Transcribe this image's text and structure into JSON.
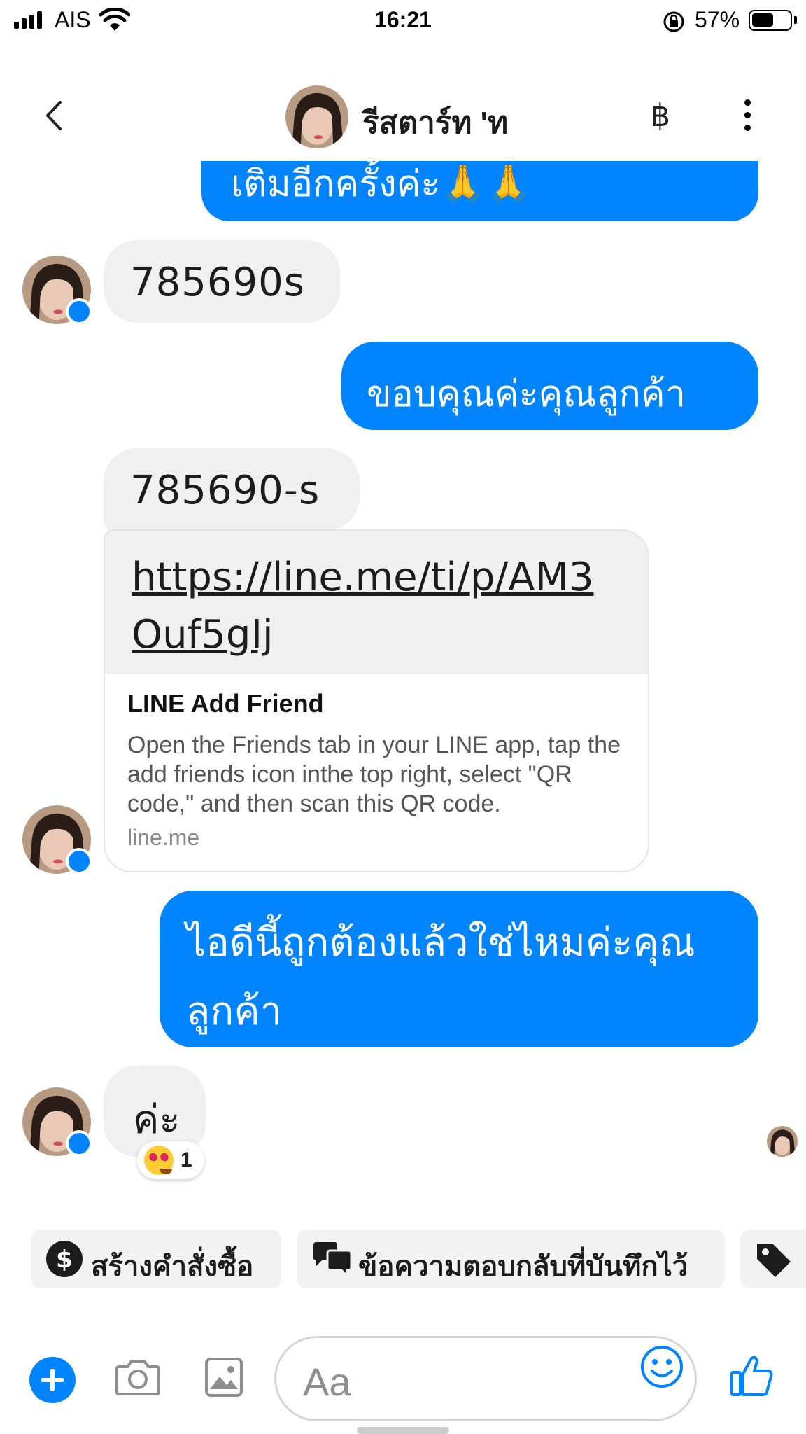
{
  "status_bar": {
    "carrier": "AIS",
    "time": "16:21",
    "battery_percent": "57%",
    "battery_level": 0.57
  },
  "header": {
    "contact_name": "รีสตาร์ท 'ท",
    "currency_symbol": "฿",
    "icons": [
      "back-icon",
      "more-options-icon"
    ]
  },
  "messages": [
    {
      "direction": "outgoing",
      "text": "เติมอีกครั้งค่ะ🙏🙏",
      "partially_visible": true
    },
    {
      "direction": "incoming",
      "text": "785690s"
    },
    {
      "direction": "outgoing",
      "text": "ขอบคุณค่ะคุณลูกค้า"
    },
    {
      "direction": "incoming",
      "text": "785690-s"
    },
    {
      "direction": "incoming",
      "type": "link_preview",
      "url": "https://line.me/ti/p/AM3Ouf5gIj",
      "title": "LINE Add Friend",
      "description": "Open the Friends tab in your LINE app, tap the add friends icon inthe top right, select \"QR code,\" and then scan this QR code.",
      "domain": "line.me"
    },
    {
      "direction": "outgoing",
      "text": "ไอดีนี้ถูกต้องแล้วใช่ไหมค่ะคุณลูกค้า"
    },
    {
      "direction": "incoming",
      "text": "ค่ะ",
      "reaction": {
        "emoji": "heart-eyes",
        "count": "1"
      }
    }
  ],
  "quick_replies": [
    {
      "label": "สร้างคำสั่งซื้อ",
      "icon": "dollar-icon"
    },
    {
      "label": "ข้อความตอบกลับที่บันทึกไว้",
      "icon": "saved-replies-icon"
    },
    {
      "label": "",
      "icon": "tag-icon"
    }
  ],
  "composer": {
    "placeholder": "Aa",
    "icons": [
      "plus-icon",
      "camera-icon",
      "image-icon",
      "emoji-icon",
      "like-icon"
    ]
  },
  "colors": {
    "accent": "#0084ff",
    "incoming_bubble": "#f0f0f0",
    "chip_bg": "#f2f2f2"
  }
}
